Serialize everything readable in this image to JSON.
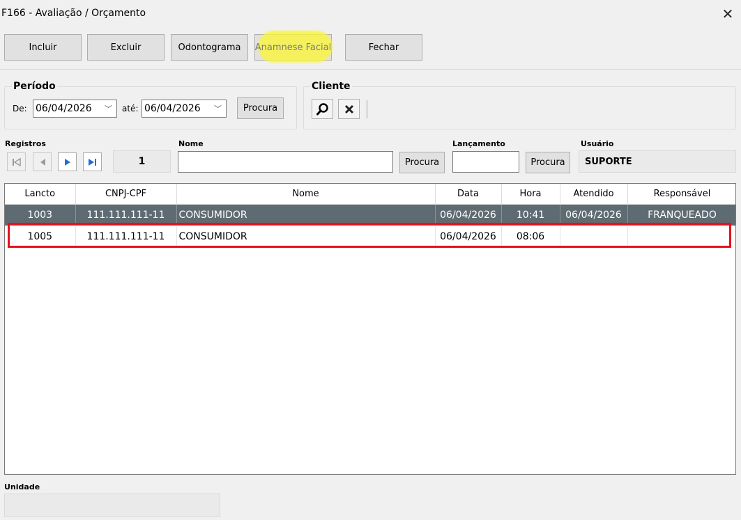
{
  "window": {
    "title": "F166 - Avaliação / Orçamento"
  },
  "toolbar": {
    "incluir": "Incluir",
    "excluir": "Excluir",
    "odontograma": "Odontograma",
    "anamnese": "Anamnese Facial",
    "fechar": "Fechar"
  },
  "periodo": {
    "label": "Período",
    "de_label": "De:",
    "de_value": "06/04/2026",
    "ate_label": "até:",
    "ate_value": "06/04/2026",
    "procura": "Procura"
  },
  "cliente": {
    "label": "Cliente"
  },
  "registros": {
    "label": "Registros",
    "count": "1"
  },
  "nome": {
    "label": "Nome",
    "value": "",
    "procura": "Procura"
  },
  "lancamento": {
    "label": "Lançamento",
    "value": "",
    "procura": "Procura"
  },
  "usuario": {
    "label": "Usuário",
    "value": "SUPORTE"
  },
  "table": {
    "headers": [
      "Lancto",
      "CNPJ-CPF",
      "Nome",
      "Data",
      "Hora",
      "Atendido",
      "Responsável"
    ],
    "rows": [
      [
        "1003",
        "111.111.111-11",
        "CONSUMIDOR",
        "06/04/2026",
        "10:41",
        "06/04/2026",
        "FRANQUEADO"
      ],
      [
        "1005",
        "111.111.111-11",
        "CONSUMIDOR",
        "06/04/2026",
        "08:06",
        "",
        ""
      ]
    ],
    "selected_row": 0,
    "highlighted_row": 1
  },
  "unidade": {
    "label": "Unidade",
    "value": ""
  },
  "colors": {
    "selection": "#5f6b72",
    "highlight_marker": "#faf53c",
    "annotation_box": "#e3121c",
    "nav_arrow": "#1f6fd6"
  }
}
